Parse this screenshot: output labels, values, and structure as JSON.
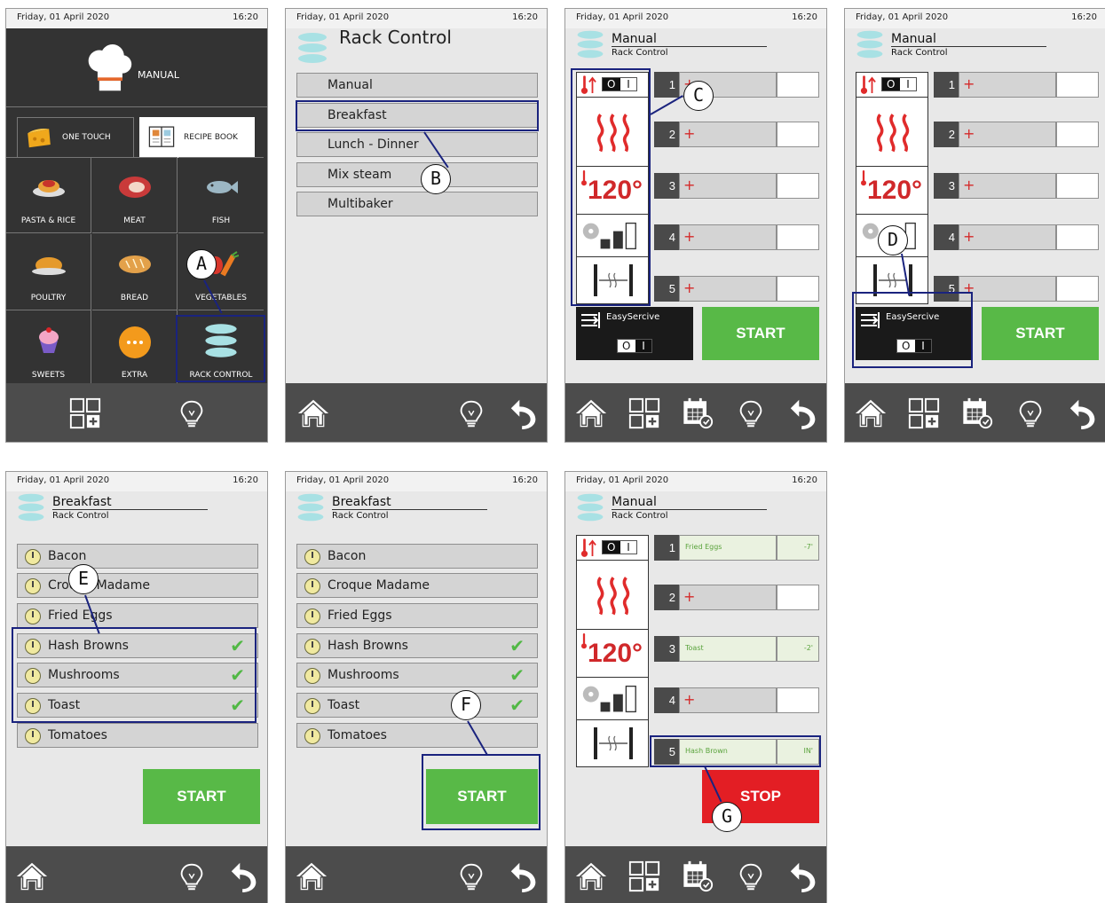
{
  "status": {
    "date": "Friday, 01 April 2020",
    "time": "16:20"
  },
  "screen1": {
    "mode": "MANUAL",
    "tabs": [
      "ONE TOUCH",
      "RECIPE BOOK"
    ],
    "tiles": [
      "PASTA & RICE",
      "MEAT",
      "FISH",
      "POULTRY",
      "BREAD",
      "VEGETABLES",
      "SWEETS",
      "EXTRA",
      "RACK CONTROL"
    ]
  },
  "screen2": {
    "title": "Rack Control",
    "items": [
      "Manual",
      "Breakfast",
      "Lunch - Dinner",
      "Mix steam",
      "Multibaker"
    ]
  },
  "manual": {
    "title": "Manual",
    "subtitle": "Rack Control",
    "temperature": "120°",
    "toggle_off": "O",
    "toggle_on": "I",
    "racks": [
      "1",
      "2",
      "3",
      "4",
      "5"
    ],
    "plus": "+",
    "easyservice": "EasySercive",
    "start": "START",
    "stop": "STOP",
    "fan_level": 0.6
  },
  "breakfast": {
    "title": "Breakfast",
    "subtitle": "Rack Control",
    "items": [
      "Bacon",
      "Croque Madame",
      "Fried Eggs",
      "Hash Browns",
      "Mushrooms",
      "Toast",
      "Tomatoes"
    ],
    "checked": [
      false,
      false,
      false,
      true,
      true,
      true,
      false
    ],
    "start": "START"
  },
  "running": {
    "rows": [
      {
        "num": "1",
        "food": "Fried Eggs",
        "timer": "-7'"
      },
      {
        "num": "2",
        "food": "",
        "timer": ""
      },
      {
        "num": "3",
        "food": "Toast",
        "timer": "-2'"
      },
      {
        "num": "4",
        "food": "",
        "timer": ""
      },
      {
        "num": "5",
        "food": "Hash Brown",
        "timer": "IN'"
      }
    ]
  },
  "callouts": [
    "A",
    "B",
    "C",
    "D",
    "E",
    "F",
    "G"
  ],
  "colors": {
    "start": "#58b947",
    "stop": "#e31e24",
    "highlight": "#1a237e",
    "temp": "#d0282a"
  }
}
